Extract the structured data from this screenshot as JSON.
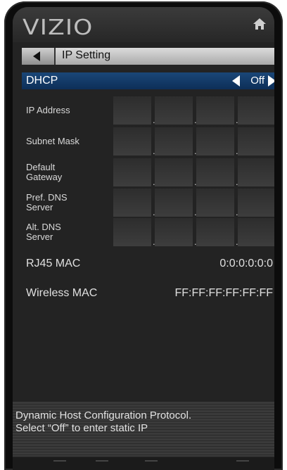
{
  "brand": {
    "logo_text": "VIZIO"
  },
  "header": {
    "title": "IP Setting"
  },
  "dhcp": {
    "label": "DHCP",
    "value": "Off"
  },
  "fields": [
    {
      "label_lines": [
        "IP Address"
      ]
    },
    {
      "label_lines": [
        "Subnet Mask"
      ]
    },
    {
      "label_lines": [
        "Default",
        "Gateway"
      ]
    },
    {
      "label_lines": [
        "Pref. DNS",
        "Server"
      ]
    },
    {
      "label_lines": [
        "Alt. DNS",
        "Server"
      ]
    }
  ],
  "info": {
    "rj45_label": "RJ45 MAC",
    "rj45_value": "0:0:0:0:0:0",
    "wireless_label": "Wireless MAC",
    "wireless_value": "FF:FF:FF:FF:FF:FF"
  },
  "description": {
    "line1": "Dynamic Host Configuration Protocol.",
    "line2": "Select “Off” to enter static IP"
  },
  "icons": {
    "home": "home-icon",
    "back": "back-arrow-icon"
  }
}
